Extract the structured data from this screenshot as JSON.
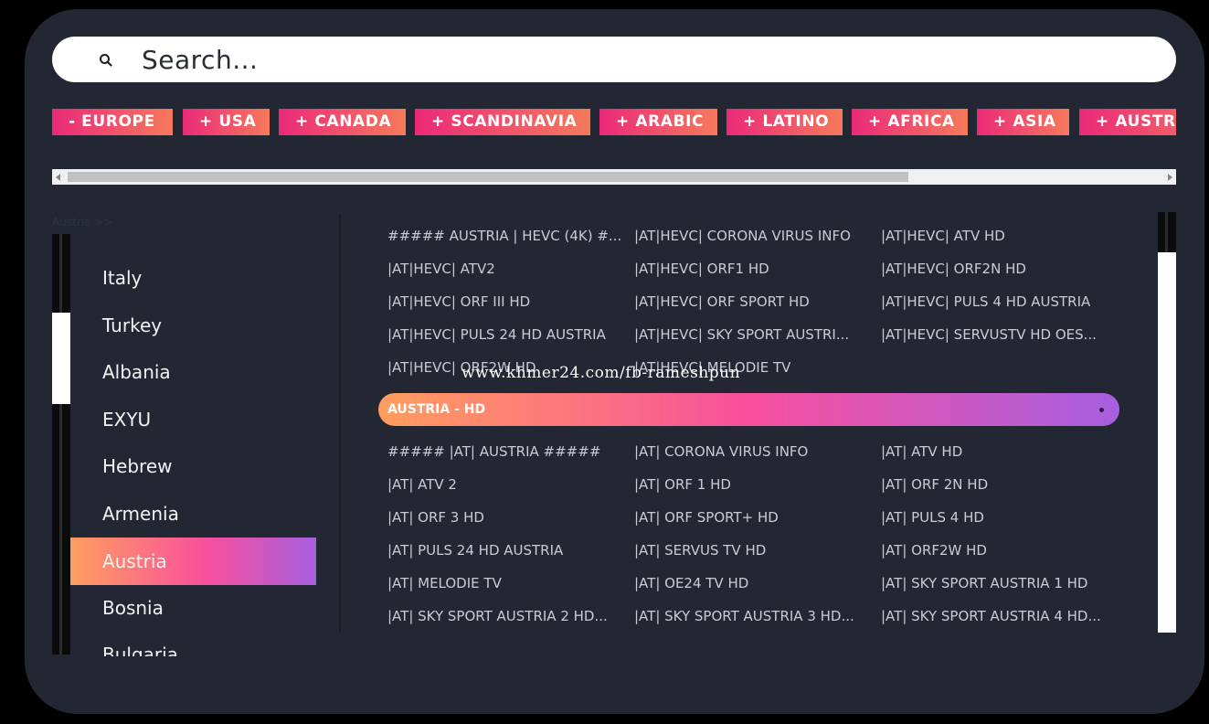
{
  "search": {
    "placeholder": "Search..."
  },
  "regions": [
    "- EUROPE",
    "+ USA",
    "+ CANADA",
    "+ SCANDINAVIA",
    "+ ARABIC",
    "+ LATINO",
    "+ AFRICA",
    "+ ASIA",
    "+ AUSTRALIA"
  ],
  "breadcrumb": "Austria >>",
  "countries": [
    "Italy",
    "Turkey",
    "Albania",
    "EXYU",
    "Hebrew",
    "Armenia",
    "Austria",
    "Bosnia",
    "Bulgaria"
  ],
  "active_country": "Austria",
  "channels_top": [
    "##### AUSTRIA | HEVC (4K) #...",
    "|AT|HEVC| CORONA VIRUS INFO",
    "|AT|HEVC| ATV HD",
    "|AT|HEVC| ATV2",
    "|AT|HEVC| ORF1 HD",
    "|AT|HEVC| ORF2N HD",
    "|AT|HEVC| ORF III HD",
    "|AT|HEVC| ORF SPORT HD",
    "|AT|HEVC| PULS 4 HD AUSTRIA",
    "|AT|HEVC| PULS 24 HD AUSTRIA",
    "|AT|HEVC| SKY SPORT AUSTRI...",
    "|AT|HEVC| SERVUSTV HD OES...",
    "|AT|HEVC| ORF2W HD",
    "|AT|HEVC| MELODIE TV"
  ],
  "group_header": "AUSTRIA - HD",
  "channels_bottom": [
    "##### |AT| AUSTRIA #####",
    "|AT| CORONA VIRUS INFO",
    "|AT| ATV HD",
    "|AT| ATV 2",
    "|AT| ORF 1 HD",
    "|AT| ORF 2N HD",
    "|AT| ORF 3 HD",
    "|AT| ORF SPORT+ HD",
    "|AT| PULS 4 HD",
    "|AT| PULS 24 HD AUSTRIA",
    "|AT| SERVUS TV HD",
    "|AT| ORF2W HD",
    "|AT| MELODIE TV",
    "|AT| OE24 TV HD",
    "|AT| SKY SPORT AUSTRIA 1 HD",
    "|AT| SKY SPORT AUSTRIA 2 HD...",
    "|AT| SKY SPORT AUSTRIA 3 HD...",
    "|AT| SKY SPORT AUSTRIA 4 HD..."
  ],
  "watermark": "www.khmer24.com/fb-rameshpun",
  "colors": {
    "panel": "#232733",
    "chip_gradient": [
      "#ea2a78",
      "#f57a5a"
    ],
    "active_gradient": [
      "#ff9e5e",
      "#f8509d",
      "#a75fe0"
    ]
  }
}
